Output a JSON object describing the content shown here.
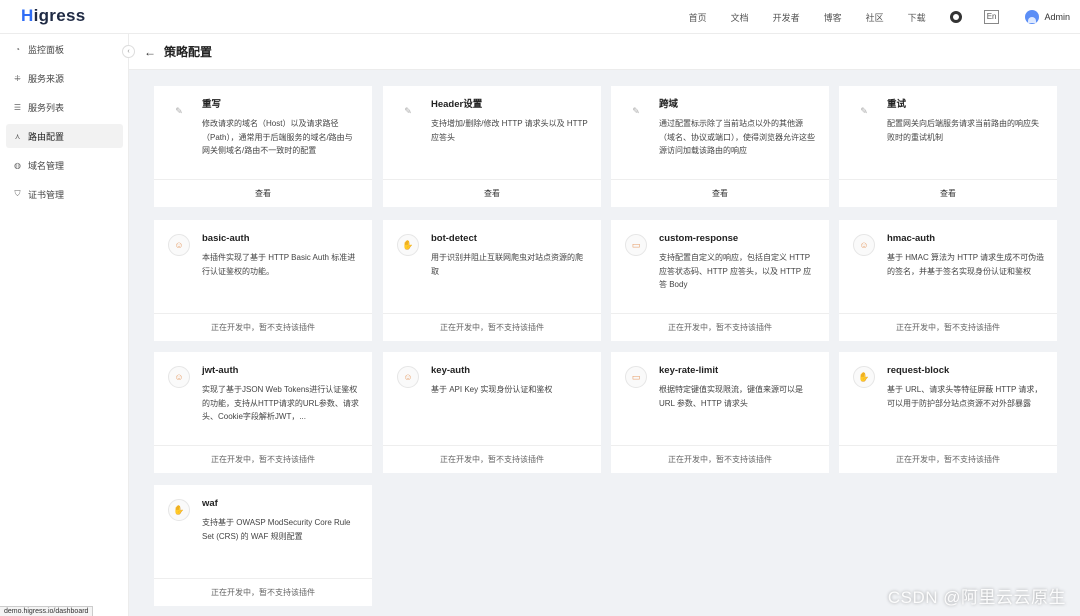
{
  "brand": {
    "logo_initial": "H",
    "logo_rest": "igress"
  },
  "nav": {
    "items": [
      "首页",
      "文档",
      "开发者",
      "博客",
      "社区",
      "下载"
    ],
    "lang": "En",
    "user": "Admin"
  },
  "sidebar": {
    "items": [
      {
        "label": "监控面板",
        "icon": "dashboard-icon",
        "active": false
      },
      {
        "label": "服务来源",
        "icon": "service-source-icon",
        "active": false
      },
      {
        "label": "服务列表",
        "icon": "list-icon",
        "active": false
      },
      {
        "label": "路由配置",
        "icon": "route-icon",
        "active": true
      },
      {
        "label": "域名管理",
        "icon": "globe-icon",
        "active": false
      },
      {
        "label": "证书管理",
        "icon": "shield-icon",
        "active": false
      }
    ]
  },
  "page": {
    "title": "策略配置"
  },
  "cards": [
    {
      "title": "重写",
      "desc": "修改请求的域名（Host）以及请求路径（Path），通常用于后端服务的域名/路由与网关侧域名/路由不一致时的配置",
      "footer": "查看",
      "icon": "plugin-icon"
    },
    {
      "title": "Header设置",
      "desc": "支持增加/删除/修改 HTTP 请求头以及 HTTP 应答头",
      "footer": "查看",
      "icon": "plugin-icon"
    },
    {
      "title": "跨域",
      "desc": "通过配置标示除了当前站点以外的其他源（域名、协议或端口），使得浏览器允许这些源访问加载该路由的响应",
      "footer": "查看",
      "icon": "plugin-icon"
    },
    {
      "title": "重试",
      "desc": "配置网关向后端服务请求当前路由的响应失败时的重试机制",
      "footer": "查看",
      "icon": "plugin-icon"
    },
    {
      "title": "basic-auth",
      "desc": "本插件实现了基于 HTTP Basic Auth 标准进行认证鉴权的功能。",
      "footer": "正在开发中，暂不支持该插件",
      "icon": "auth-icon"
    },
    {
      "title": "bot-detect",
      "desc": "用于识别并阻止互联网爬虫对站点资源的爬取",
      "footer": "正在开发中，暂不支持该插件",
      "icon": "hand-icon"
    },
    {
      "title": "custom-response",
      "desc": "支持配置自定义的响应，包括自定义 HTTP 应答状态码、HTTP 应答头，以及 HTTP 应答 Body",
      "footer": "正在开发中，暂不支持该插件",
      "icon": "response-icon"
    },
    {
      "title": "hmac-auth",
      "desc": "基于 HMAC 算法为 HTTP 请求生成不可伪造的签名，并基于签名实现身份认证和鉴权",
      "footer": "正在开发中，暂不支持该插件",
      "icon": "auth-icon"
    },
    {
      "title": "jwt-auth",
      "desc": "实现了基于JSON Web Tokens进行认证鉴权的功能，支持从HTTP请求的URL参数、请求头、Cookie字段解析JWT，...",
      "footer": "正在开发中，暂不支持该插件",
      "icon": "auth-icon"
    },
    {
      "title": "key-auth",
      "desc": "基于 API Key 实现身份认证和鉴权",
      "footer": "正在开发中，暂不支持该插件",
      "icon": "auth-icon"
    },
    {
      "title": "key-rate-limit",
      "desc": "根据特定键值实现限流，键值来源可以是 URL 参数、HTTP 请求头",
      "footer": "正在开发中，暂不支持该插件",
      "icon": "response-icon"
    },
    {
      "title": "request-block",
      "desc": "基于 URL、请求头等特征屏蔽 HTTP 请求，可以用于防护部分站点资源不对外部暴露",
      "footer": "正在开发中，暂不支持该插件",
      "icon": "hand-icon"
    },
    {
      "title": "waf",
      "desc": "支持基于 OWASP ModSecurity Core Rule Set (CRS) 的 WAF 规则配置",
      "footer": "正在开发中，暂不支持该插件",
      "icon": "hand-icon"
    }
  ],
  "status_url": "demo.higress.io/dashboard",
  "watermark": "CSDN @阿里云云原生"
}
